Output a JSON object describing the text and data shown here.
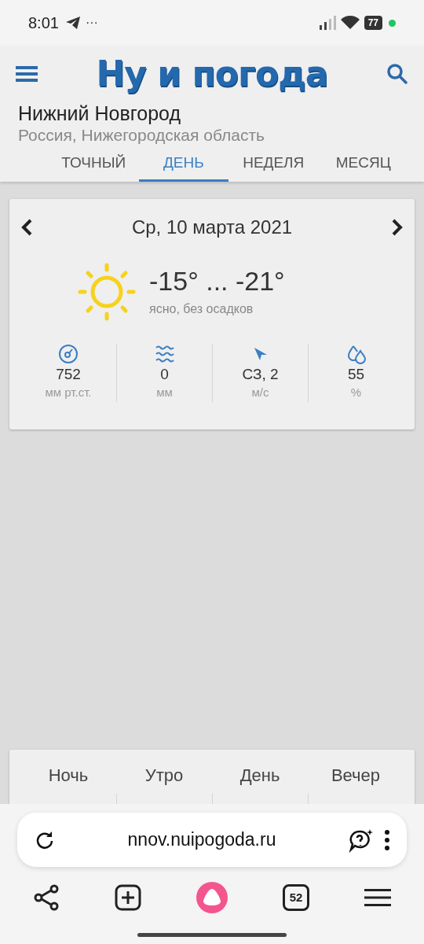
{
  "status_bar": {
    "time": "8:01",
    "more": "···",
    "battery": "77"
  },
  "header": {
    "logo": "Ну и погода",
    "city": "Нижний Новгород",
    "region": "Россия, Нижегородская область"
  },
  "tabs": [
    {
      "label": "ТОЧНЫЙ",
      "selected": false
    },
    {
      "label": "ДЕНЬ",
      "selected": true
    },
    {
      "label": "НЕДЕЛЯ",
      "selected": false
    },
    {
      "label": "МЕСЯЦ",
      "selected": false
    }
  ],
  "day_card": {
    "date": "Ср, 10 марта 2021",
    "temperature": "-15° ... -21°",
    "condition": "ясно, без осадков",
    "stats": [
      {
        "kind": "pressure",
        "value": "752",
        "unit": "мм рт.ст."
      },
      {
        "kind": "precipitation",
        "value": "0",
        "unit": "мм"
      },
      {
        "kind": "wind",
        "value": "СЗ, 2",
        "unit": "м/с"
      },
      {
        "kind": "humidity",
        "value": "55",
        "unit": "%"
      }
    ]
  },
  "periods": [
    {
      "label": "Ночь"
    },
    {
      "label": "Утро"
    },
    {
      "label": "День"
    },
    {
      "label": "Вечер"
    }
  ],
  "browser": {
    "url": "nnov.nuipogoda.ru",
    "tab_count": "52"
  }
}
